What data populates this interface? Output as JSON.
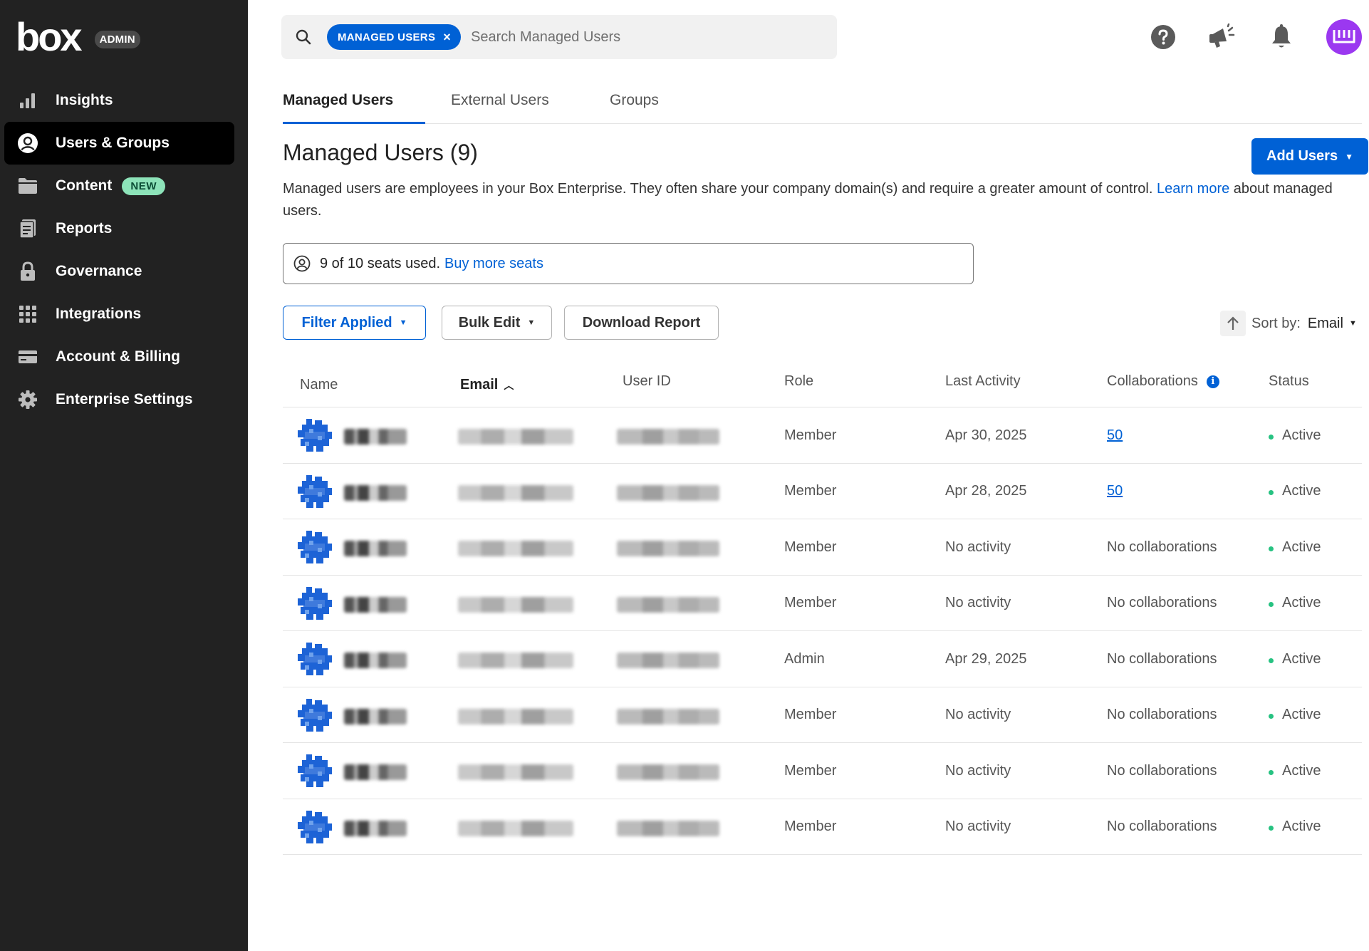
{
  "brand": {
    "logo_text": "box",
    "badge": "ADMIN"
  },
  "nav": {
    "items": [
      {
        "label": "Insights",
        "icon": "bar-chart-icon"
      },
      {
        "label": "Users & Groups",
        "icon": "user-circle-icon",
        "active": true
      },
      {
        "label": "Content",
        "icon": "folder-icon",
        "badge": "NEW"
      },
      {
        "label": "Reports",
        "icon": "report-icon"
      },
      {
        "label": "Governance",
        "icon": "lock-icon"
      },
      {
        "label": "Integrations",
        "icon": "grid-icon"
      },
      {
        "label": "Account & Billing",
        "icon": "credit-card-icon"
      },
      {
        "label": "Enterprise Settings",
        "icon": "gear-icon"
      }
    ]
  },
  "search": {
    "pill_label": "MANAGED USERS",
    "placeholder": "Search Managed Users"
  },
  "top_icons": [
    "help-icon",
    "announcement-icon",
    "notification-bell-icon",
    "user-avatar-icon"
  ],
  "tabs": [
    {
      "label": "Managed Users",
      "active": true
    },
    {
      "label": "External Users"
    },
    {
      "label": "Groups"
    }
  ],
  "header": {
    "title": "Managed Users (9)",
    "add_button": "Add Users",
    "description_before": "Managed users are employees in your Box Enterprise. They often share your company domain(s) and require a greater amount of control.",
    "learn_more": "Learn more",
    "description_after": "about managed users."
  },
  "seats": {
    "text": "9 of 10 seats used.",
    "link": "Buy more seats"
  },
  "toolbar": {
    "filter_label": "Filter Applied",
    "bulk_edit_label": "Bulk Edit",
    "download_label": "Download Report",
    "sort_label": "Sort by:",
    "sort_value": "Email"
  },
  "table": {
    "columns": [
      "Name",
      "Email",
      "User ID",
      "Role",
      "Last Activity",
      "Collaborations",
      "Status"
    ],
    "rows": [
      {
        "role": "Member",
        "last_activity": "Apr 30, 2025",
        "collaborations": "50",
        "collab_link": true,
        "status": "Active"
      },
      {
        "role": "Member",
        "last_activity": "Apr 28, 2025",
        "collaborations": "50",
        "collab_link": true,
        "status": "Active"
      },
      {
        "role": "Member",
        "last_activity": "No activity",
        "collaborations": "No collaborations",
        "collab_link": false,
        "status": "Active"
      },
      {
        "role": "Member",
        "last_activity": "No activity",
        "collaborations": "No collaborations",
        "collab_link": false,
        "status": "Active"
      },
      {
        "role": "Admin",
        "last_activity": "Apr 29, 2025",
        "collaborations": "No collaborations",
        "collab_link": false,
        "status": "Active"
      },
      {
        "role": "Member",
        "last_activity": "No activity",
        "collaborations": "No collaborations",
        "collab_link": false,
        "status": "Active"
      },
      {
        "role": "Member",
        "last_activity": "No activity",
        "collaborations": "No collaborations",
        "collab_link": false,
        "status": "Active"
      },
      {
        "role": "Member",
        "last_activity": "No activity",
        "collaborations": "No collaborations",
        "collab_link": false,
        "status": "Active"
      }
    ]
  },
  "colors": {
    "accent": "#0061d5",
    "sidebar": "#222222",
    "status_active": "#26c281",
    "avatar": "#9b38f0",
    "new_badge": "#8de3b9"
  }
}
